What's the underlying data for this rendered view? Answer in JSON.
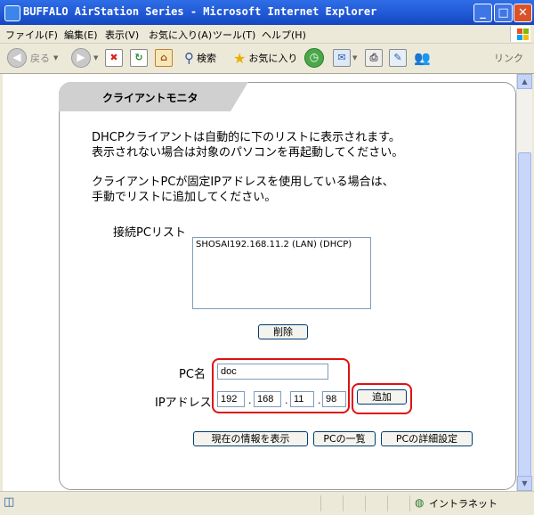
{
  "window": {
    "title": "BUFFALO AirStation Series - Microsoft Internet Explorer",
    "min": "_",
    "max": "□",
    "close": "✕"
  },
  "menu": [
    "ファイル(F)",
    "編集(E)",
    "表示(V)",
    "お気に入り(A)",
    "ツール(T)",
    "ヘルプ(H)"
  ],
  "toolbar": {
    "back": "戻る",
    "search": "検索",
    "favorites": "お気に入り",
    "links": "リンク"
  },
  "page": {
    "tab_title": "クライアントモニタ",
    "desc1": "DHCPクライアントは自動的に下のリストに表示されます。",
    "desc2": "表示されない場合は対象のパソコンを再起動してください。",
    "desc3": "クライアントPCが固定IPアドレスを使用している場合は、",
    "desc4": "手動でリストに追加してください。",
    "list_label": "接続PCリスト",
    "list_items": [
      "SHOSAI192.168.11.2 (LAN) (DHCP)"
    ],
    "delete_button": "削除",
    "pc_name_label": "PC名",
    "pc_name_value": "doc",
    "ip_label": "IPアドレス",
    "ip": [
      "192",
      "168",
      "11",
      "98"
    ],
    "ip_sep": ".",
    "add_button": "追加",
    "show_current_button": "現在の情報を表示",
    "pc_list_button": "PCの一覧",
    "pc_detail_button": "PCの詳細設定"
  },
  "status": {
    "zone": "イントラネット"
  },
  "colors": {
    "highlight": "#e01010",
    "titlebar": "#245edb"
  }
}
